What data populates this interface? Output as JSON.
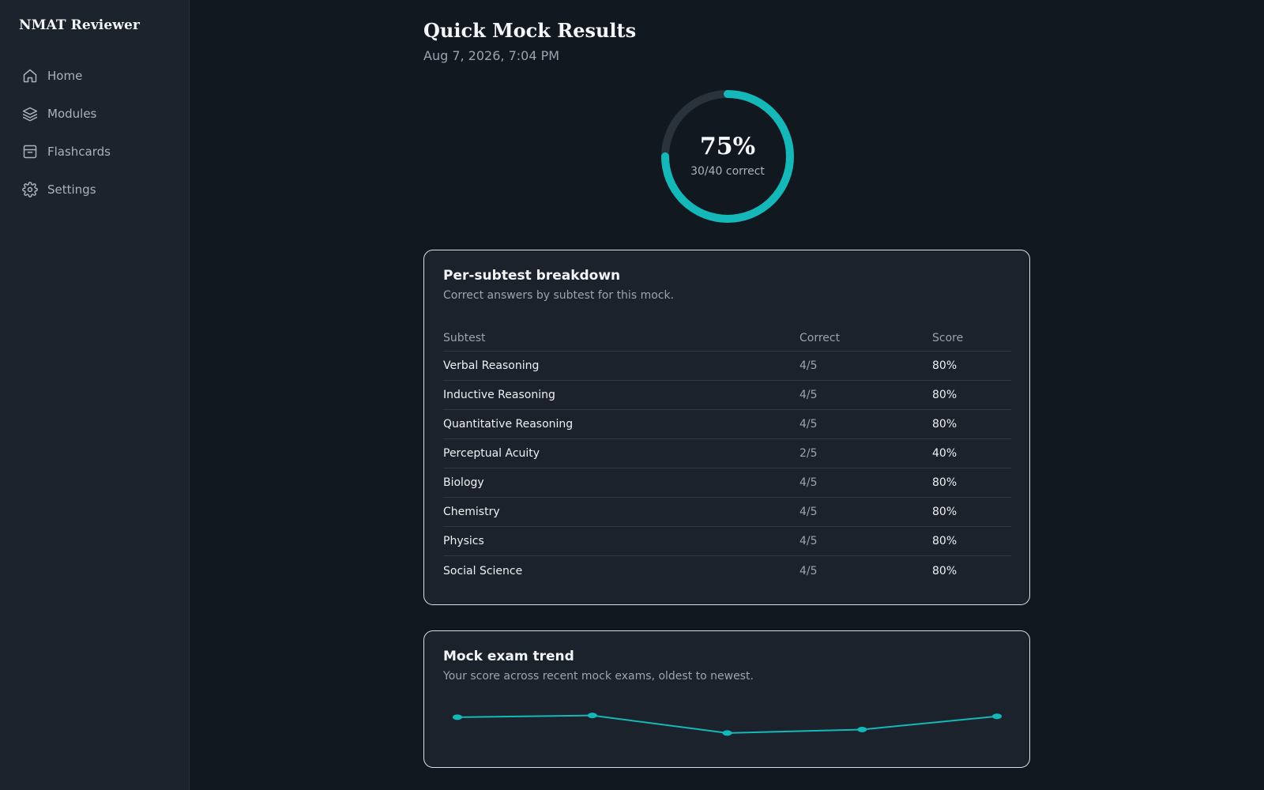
{
  "app": {
    "title": "NMAT Reviewer"
  },
  "sidebar": {
    "items": [
      {
        "label": "Home",
        "icon": "home-icon"
      },
      {
        "label": "Modules",
        "icon": "layers-icon"
      },
      {
        "label": "Flashcards",
        "icon": "archive-icon"
      },
      {
        "label": "Settings",
        "icon": "gear-icon"
      }
    ]
  },
  "header": {
    "title": "Quick Mock Results",
    "timestamp": "Aug 7, 2026, 7:04 PM"
  },
  "score": {
    "percent_label": "75%",
    "detail": "30/40 correct",
    "fraction": 0.75
  },
  "breakdown": {
    "title": "Per-subtest breakdown",
    "description": "Correct answers by subtest for this mock.",
    "columns": [
      "Subtest",
      "Correct",
      "Score"
    ],
    "rows": [
      {
        "subtest": "Verbal Reasoning",
        "correct": "4/5",
        "score": "80%"
      },
      {
        "subtest": "Inductive Reasoning",
        "correct": "4/5",
        "score": "80%"
      },
      {
        "subtest": "Quantitative Reasoning",
        "correct": "4/5",
        "score": "80%"
      },
      {
        "subtest": "Perceptual Acuity",
        "correct": "2/5",
        "score": "40%"
      },
      {
        "subtest": "Biology",
        "correct": "4/5",
        "score": "80%"
      },
      {
        "subtest": "Chemistry",
        "correct": "4/5",
        "score": "80%"
      },
      {
        "subtest": "Physics",
        "correct": "4/5",
        "score": "80%"
      },
      {
        "subtest": "Social Science",
        "correct": "4/5",
        "score": "80%"
      }
    ]
  },
  "trend": {
    "title": "Mock exam trend",
    "description": "Your score across recent mock exams, oldest to newest."
  },
  "colors": {
    "accent": "#14b8b8",
    "ring_track": "#2a323c",
    "background": "#111820",
    "sidebar": "#1d232d",
    "card": "#1c222b"
  },
  "chart_data": {
    "type": "line",
    "title": "",
    "xlabel": "",
    "ylabel": "",
    "x": [
      1,
      2,
      3,
      4,
      5
    ],
    "values": [
      76,
      77,
      67,
      69,
      76.5
    ],
    "ylim": [
      62,
      80
    ],
    "grid": false
  }
}
